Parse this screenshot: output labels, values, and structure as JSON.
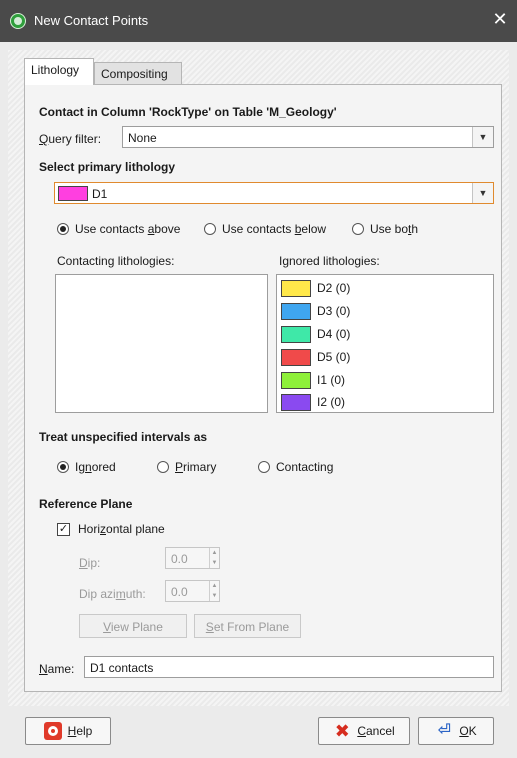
{
  "window": {
    "title": "New Contact Points",
    "close_glyph": "✕"
  },
  "tabs": [
    {
      "label": "Lithology"
    },
    {
      "label": "Compositing"
    }
  ],
  "contact_heading": "Contact in Column 'RockType' on Table 'M_Geology'",
  "query_filter": {
    "label_u": "Q",
    "label_rest": "uery filter:",
    "value": "None"
  },
  "primary": {
    "heading": "Select primary lithology",
    "value": "D1",
    "color": "#ff3fe0"
  },
  "contact_mode": {
    "above": {
      "pre": "Use contacts ",
      "u": "a",
      "post": "bove",
      "selected": true
    },
    "below": {
      "pre": "Use contacts ",
      "u": "b",
      "post": "elow",
      "selected": false
    },
    "both": {
      "pre": "Use bo",
      "u": "t",
      "post": "h",
      "selected": false
    }
  },
  "contacting_label": "Contacting lithologies:",
  "ignored_label": "Ignored lithologies:",
  "ignored_items": [
    {
      "label": "D2 (0)",
      "color": "#ffe84a"
    },
    {
      "label": "D3 (0)",
      "color": "#3fa6f0"
    },
    {
      "label": "D4 (0)",
      "color": "#3fe8a8"
    },
    {
      "label": "D5 (0)",
      "color": "#f04a4a"
    },
    {
      "label": "I1 (0)",
      "color": "#8ef03a"
    },
    {
      "label": "I2 (0)",
      "color": "#8a4af0"
    }
  ],
  "unspecified": {
    "heading": "Treat unspecified intervals as",
    "ignored": {
      "pre": "Ig",
      "u": "n",
      "post": "ored",
      "selected": true
    },
    "primary": {
      "pre": "",
      "u": "P",
      "post": "rimary",
      "selected": false
    },
    "contacting": {
      "pre": "Contacting",
      "u": "",
      "post": "",
      "selected": false
    }
  },
  "reference_plane": {
    "heading": "Reference Plane",
    "horizontal": {
      "pre": "Hori",
      "u": "z",
      "post": "ontal plane",
      "checked": true
    },
    "dip": {
      "pre": "",
      "u": "D",
      "post": "ip:",
      "value": "0.0"
    },
    "dip_azimuth": {
      "pre": "Dip azi",
      "u": "m",
      "post": "uth:",
      "value": "0.0"
    },
    "view_plane": {
      "pre": "",
      "u": "V",
      "post": "iew Plane"
    },
    "set_from_plane": {
      "pre": "",
      "u": "S",
      "post": "et From Plane"
    }
  },
  "name_field": {
    "label_u": "N",
    "label_rest": "ame:",
    "value": "D1 contacts"
  },
  "buttons": {
    "help": {
      "u": "H",
      "rest": "elp"
    },
    "cancel": {
      "u": "C",
      "rest": "ancel"
    },
    "ok": {
      "u": "O",
      "rest": "K"
    }
  },
  "icons": {
    "app": "contact-points-app-icon",
    "help": "lifebuoy-icon",
    "cancel": "cancel-x-icon",
    "ok": "ok-arrow-icon",
    "dropdown": "▼",
    "spin_up": "▲",
    "spin_down": "▼"
  }
}
